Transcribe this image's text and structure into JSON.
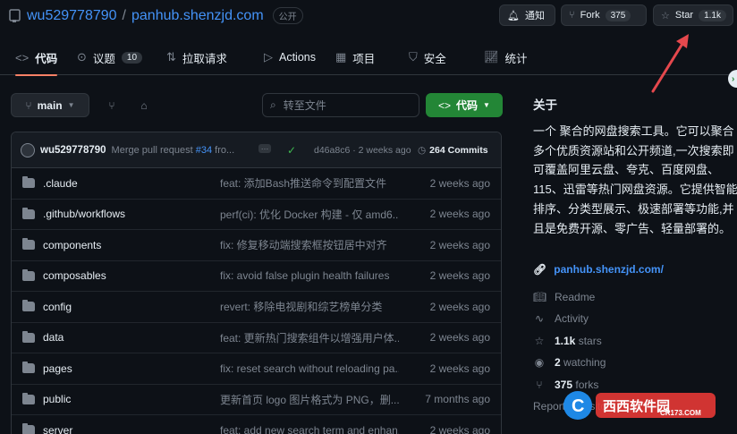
{
  "repo": {
    "owner": "wu529778790",
    "separator": "/",
    "name": "panhub.shenzjd.com",
    "visibility": "公开"
  },
  "header_buttons": {
    "notify_label": "通知",
    "fork_label": "Fork",
    "fork_count": "375",
    "star_label": "Star",
    "star_count": "1.1k"
  },
  "tabs": [
    {
      "label": "代码",
      "icon": "code-icon"
    },
    {
      "label": "议题",
      "icon": "issue-icon",
      "count": "10"
    },
    {
      "label": "拉取请求",
      "icon": "pull-request-icon"
    },
    {
      "label": "Actions",
      "icon": "play-icon"
    },
    {
      "label": "项目",
      "icon": "table-icon"
    },
    {
      "label": "安全",
      "icon": "shield-icon"
    },
    {
      "label": "统计",
      "icon": "graph-icon"
    }
  ],
  "toolbar": {
    "branch": "main",
    "search_placeholder": "转至文件",
    "code_button": "代码"
  },
  "commit": {
    "user": "wu529778790",
    "message_prefix": "Merge pull request ",
    "pr": "#34",
    "message_suffix": " fro...",
    "sha_time": "d46a8c6 · 2 weeks ago",
    "commits": "264 Commits"
  },
  "files": [
    {
      "name": ".claude",
      "message": "feat: 添加Bash推送命令到配置文件",
      "date": "2 weeks ago"
    },
    {
      "name": ".github/workflows",
      "message": "perf(ci): 优化 Docker 构建 - 仅 amd6...",
      "date": "2 weeks ago"
    },
    {
      "name": "components",
      "message": "fix: 修复移动端搜索框按钮居中对齐",
      "date": "2 weeks ago"
    },
    {
      "name": "composables",
      "message": "fix: avoid false plugin health failures",
      "date": "2 weeks ago"
    },
    {
      "name": "config",
      "message": "revert: 移除电视剧和综艺榜单分类",
      "date": "2 weeks ago"
    },
    {
      "name": "data",
      "message": "feat: 更新热门搜索组件以增强用户体...",
      "date": "2 weeks ago"
    },
    {
      "name": "pages",
      "message": "fix: reset search without reloading pa...",
      "date": "2 weeks ago"
    },
    {
      "name": "public",
      "message": "更新首页 logo 图片格式为 PNG，删...",
      "date": "7 months ago"
    },
    {
      "name": "server",
      "message": "feat: add new search term and enhan...",
      "date": "2 weeks ago"
    }
  ],
  "about": {
    "title": "关于",
    "description": "一个 聚合的网盘搜索工具。它可以聚合多个优质资源站和公开频道,一次搜索即可覆盖阿里云盘、夸克、百度网盘、115、迅雷等热门网盘资源。它提供智能排序、分类型展示、极速部署等功能,并且是免费开源、零广告、轻量部署的。",
    "link": "panhub.shenzjd.com/",
    "readme": "Readme",
    "activity": "Activity",
    "stars_num": "1.1k",
    "stars_label": " stars",
    "watching_num": "2",
    "watching_label": " watching",
    "forks_num": "375",
    "forks_label": " forks",
    "report": "Report repository"
  },
  "watermark": {
    "text": "西西软件园",
    "sub": "CR173.COM"
  },
  "colors": {
    "accent_blue": "#4493f8",
    "green": "#238636",
    "tab_underline": "#f78166",
    "arrow": "#e5484d"
  }
}
